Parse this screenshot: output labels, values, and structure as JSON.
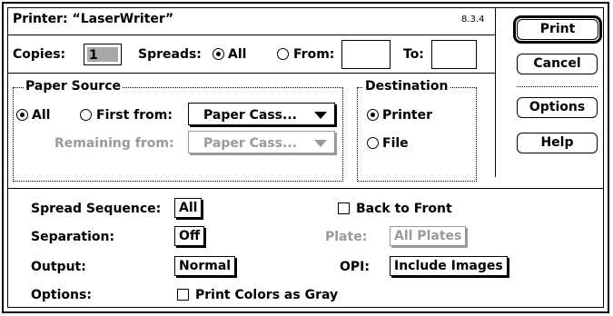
{
  "dialog": {
    "title": "Printer: “LaserWriter”",
    "version": "8.3.4"
  },
  "copies": {
    "label": "Copies:",
    "value": "1"
  },
  "spreads": {
    "label": "Spreads:",
    "all_label": "All",
    "from_label": "From:",
    "to_label": "To:",
    "from_value": "",
    "to_value": "",
    "selected": "all"
  },
  "paper_source": {
    "legend": "Paper Source",
    "all_label": "All",
    "first_from_label": "First from:",
    "first_from_value": "Paper Cass...",
    "remaining_from_label": "Remaining from:",
    "remaining_from_value": "Paper Cass...",
    "selected": "all"
  },
  "destination": {
    "legend": "Destination",
    "printer_label": "Printer",
    "file_label": "File",
    "selected": "printer"
  },
  "buttons": {
    "print": "Print",
    "cancel": "Cancel",
    "options": "Options",
    "help": "Help"
  },
  "spread_sequence": {
    "label": "Spread Sequence:",
    "value": "All"
  },
  "back_to_front": {
    "label": "Back to Front",
    "checked": false
  },
  "separation": {
    "label": "Separation:",
    "value": "Off"
  },
  "plate": {
    "label": "Plate:",
    "value": "All Plates"
  },
  "output": {
    "label": "Output:",
    "value": "Normal"
  },
  "opi": {
    "label": "OPI:",
    "value": "Include Images"
  },
  "options": {
    "label": "Options:",
    "print_gray_label": "Print Colors as Gray",
    "print_gray_checked": false
  }
}
